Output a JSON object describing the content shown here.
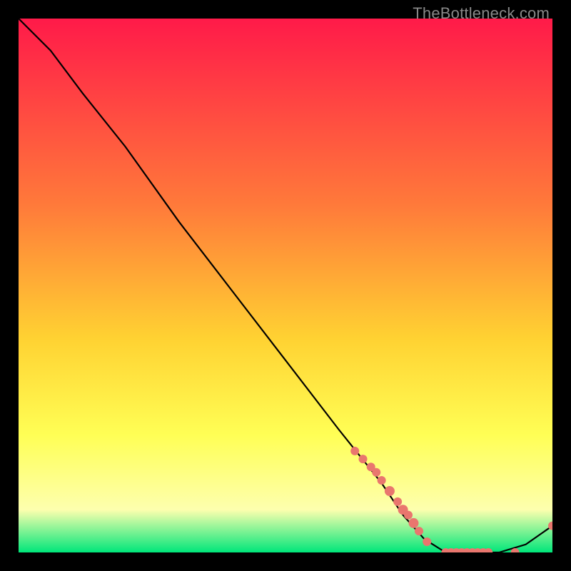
{
  "watermark": "TheBottleneck.com",
  "colors": {
    "line": "#000000",
    "marker": "#e9766e",
    "grad_top": "#ff1a49",
    "grad_mid1": "#ff7a3a",
    "grad_mid2": "#ffd232",
    "grad_mid3": "#ffff55",
    "grad_mid4": "#fdffae",
    "grad_bot": "#00e67a",
    "bg": "#000000"
  },
  "chart_data": {
    "type": "line",
    "title": "",
    "xlabel": "",
    "ylabel": "",
    "xlim": [
      0,
      100
    ],
    "ylim": [
      0,
      100
    ],
    "grid": false,
    "legend": false,
    "series": [
      {
        "name": "curve",
        "x": [
          0,
          6,
          12,
          20,
          30,
          40,
          50,
          60,
          68,
          72,
          76,
          80,
          85,
          90,
          95,
          100
        ],
        "y": [
          100,
          94,
          86,
          76,
          62,
          49,
          36,
          23,
          13,
          7,
          2.5,
          0,
          0,
          0,
          1.5,
          5
        ]
      }
    ],
    "markers": {
      "name": "data-points",
      "x": [
        63,
        64.5,
        66,
        67,
        68,
        69.5,
        71,
        72,
        73,
        74,
        75,
        76.5,
        80,
        81,
        82,
        83,
        84,
        85,
        86,
        87,
        88,
        93,
        100
      ],
      "y": [
        19,
        17.5,
        16,
        15,
        13.5,
        11.5,
        9.5,
        8,
        7,
        5.5,
        4,
        2,
        0,
        0,
        0,
        0,
        0,
        0,
        0,
        0,
        0,
        0,
        5
      ],
      "r": [
        6,
        6,
        6,
        6,
        6,
        7,
        6,
        7,
        6,
        7,
        6,
        6,
        6,
        6,
        6,
        6,
        6,
        6,
        6,
        6,
        6,
        6,
        6
      ]
    }
  }
}
